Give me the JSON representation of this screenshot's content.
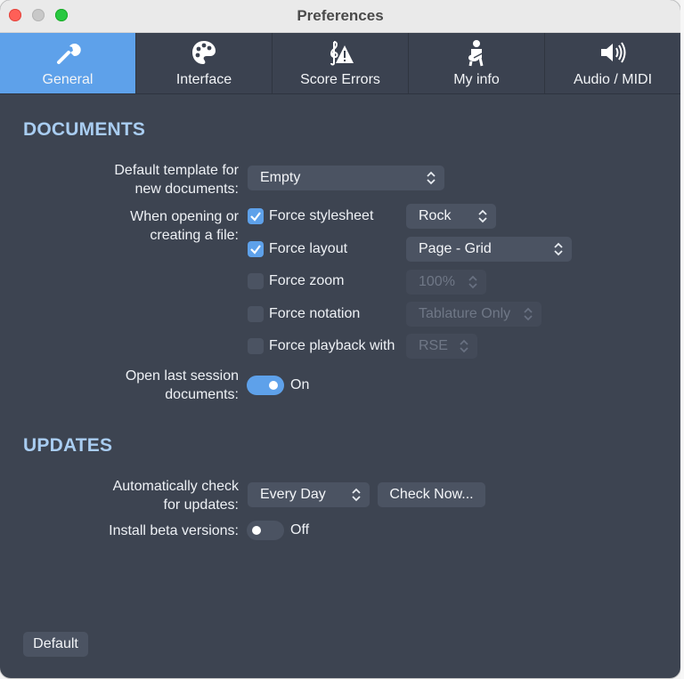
{
  "window": {
    "title": "Preferences"
  },
  "tabs": [
    {
      "label": "General",
      "icon": "wrench-icon",
      "active": true
    },
    {
      "label": "Interface",
      "icon": "palette-icon",
      "active": false
    },
    {
      "label": "Score Errors",
      "icon": "clef-warning-icon",
      "active": false
    },
    {
      "label": "My info",
      "icon": "guitarist-icon",
      "active": false
    },
    {
      "label": "Audio / MIDI",
      "icon": "speaker-icon",
      "active": false
    }
  ],
  "documents": {
    "heading": "DOCUMENTS",
    "default_template": {
      "label_line1": "Default template for",
      "label_line2": "new documents:",
      "value": "Empty"
    },
    "opening": {
      "label_line1": "When opening or",
      "label_line2": "creating a file:",
      "force_stylesheet": {
        "label": "Force stylesheet",
        "checked": true,
        "value": "Rock"
      },
      "force_layout": {
        "label": "Force layout",
        "checked": true,
        "value": "Page - Grid"
      },
      "force_zoom": {
        "label": "Force zoom",
        "checked": false,
        "value": "100%"
      },
      "force_notation": {
        "label": "Force notation",
        "checked": false,
        "value": "Tablature Only"
      },
      "force_playback": {
        "label": "Force playback with",
        "checked": false,
        "value": "RSE"
      }
    },
    "last_session": {
      "label_line1": "Open last session",
      "label_line2": "documents:",
      "state": "On",
      "on": true
    }
  },
  "updates": {
    "heading": "UPDATES",
    "auto_check": {
      "label_line1": "Automatically check",
      "label_line2": "for updates:",
      "value": "Every Day",
      "check_now": "Check Now..."
    },
    "beta": {
      "label": "Install beta versions:",
      "state": "Off",
      "on": false
    }
  },
  "footer": {
    "default_button": "Default"
  },
  "colors": {
    "accent": "#5ea1ea",
    "panel": "#3d4451",
    "heading": "#a9cdf1"
  }
}
